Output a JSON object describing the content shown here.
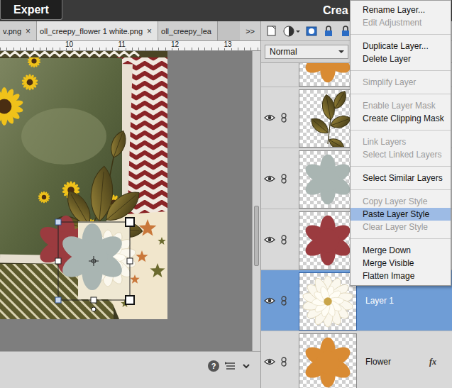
{
  "app": {
    "mode_button": "Expert",
    "title": "Crea"
  },
  "doc_tabs": [
    {
      "label": "v.png",
      "close": "×",
      "selected": false
    },
    {
      "label": "oll_creepy_flower 1 white.png",
      "close": "×",
      "selected": true
    },
    {
      "label": "oll_creepy_lea",
      "selected": false
    }
  ],
  "tab_overflow": ">>",
  "ruler": {
    "labels": [
      "10",
      "11",
      "12",
      "13"
    ]
  },
  "footer": {
    "help": "?"
  },
  "layers_panel": {
    "blend_mode": "Normal",
    "layers": [
      {
        "kind": "flower",
        "color": "#d98b33",
        "visible": true,
        "selected": false
      },
      {
        "kind": "leaves",
        "visible": true,
        "selected": false
      },
      {
        "kind": "flower",
        "color": "#a9b5b2",
        "visible": true,
        "selected": false
      },
      {
        "kind": "flower",
        "color": "#9b3b3f",
        "visible": true,
        "selected": false
      },
      {
        "kind": "photo",
        "name": "Layer 1",
        "visible": true,
        "selected": true
      },
      {
        "kind": "flower",
        "color": "#d98b33",
        "name": "Flower",
        "badge": "fx",
        "visible": true,
        "selected": false
      }
    ]
  },
  "context_menu": {
    "items": [
      {
        "kind": "item",
        "label": "Rename Layer...",
        "disabled": false,
        "selected": false
      },
      {
        "kind": "item",
        "label": "Edit Adjustment",
        "disabled": true,
        "selected": false
      },
      {
        "kind": "separator"
      },
      {
        "kind": "item",
        "label": "Duplicate Layer...",
        "disabled": false,
        "selected": false
      },
      {
        "kind": "item",
        "label": "Delete Layer",
        "disabled": false,
        "selected": false
      },
      {
        "kind": "separator"
      },
      {
        "kind": "item",
        "label": "Simplify Layer",
        "disabled": true,
        "selected": false
      },
      {
        "kind": "separator"
      },
      {
        "kind": "item",
        "label": "Enable Layer Mask",
        "disabled": true,
        "selected": false
      },
      {
        "kind": "item",
        "label": "Create Clipping Mask",
        "disabled": false,
        "selected": false
      },
      {
        "kind": "separator"
      },
      {
        "kind": "item",
        "label": "Link Layers",
        "disabled": true,
        "selected": false
      },
      {
        "kind": "item",
        "label": "Select Linked Layers",
        "disabled": true,
        "selected": false
      },
      {
        "kind": "separator"
      },
      {
        "kind": "item",
        "label": "Select Similar Layers",
        "disabled": false,
        "selected": false
      },
      {
        "kind": "separator"
      },
      {
        "kind": "item",
        "label": "Copy Layer Style",
        "disabled": true,
        "selected": false
      },
      {
        "kind": "item",
        "label": "Paste Layer Style",
        "disabled": false,
        "selected": true
      },
      {
        "kind": "item",
        "label": "Clear Layer Style",
        "disabled": true,
        "selected": false
      },
      {
        "kind": "separator"
      },
      {
        "kind": "item",
        "label": "Merge Down",
        "disabled": false,
        "selected": false
      },
      {
        "kind": "item",
        "label": "Merge Visible",
        "disabled": false,
        "selected": false
      },
      {
        "kind": "item",
        "label": "Flatten Image",
        "disabled": false,
        "selected": false
      }
    ]
  }
}
